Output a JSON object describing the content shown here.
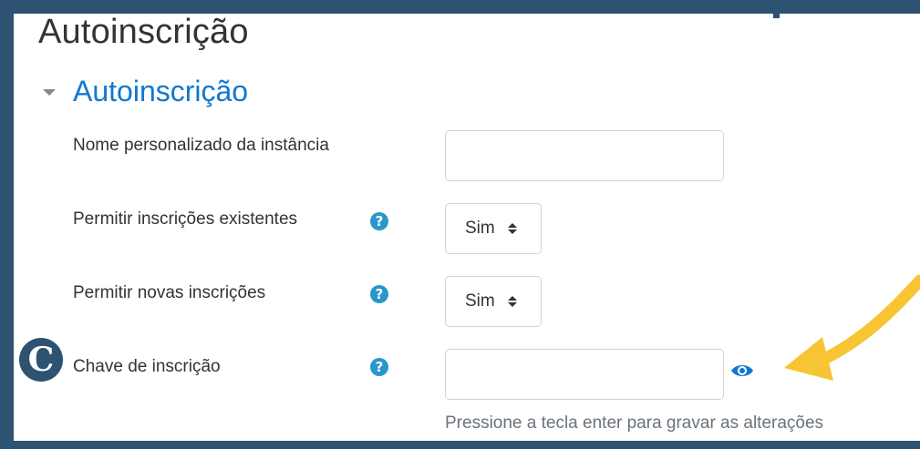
{
  "page": {
    "title": "Autoinscrição"
  },
  "section": {
    "title": "Autoinscrição",
    "toggle_icon": "caret-down-icon"
  },
  "form": {
    "instance_name": {
      "label": "Nome personalizado da instância",
      "value": ""
    },
    "allow_existing": {
      "label": "Permitir inscrições existentes",
      "value": "Sim",
      "help_icon": "question-circle-icon"
    },
    "allow_new": {
      "label": "Permitir novas inscrições",
      "value": "Sim",
      "help_icon": "question-circle-icon"
    },
    "enrolment_key": {
      "label": "Chave de inscrição",
      "value": "",
      "help_icon": "question-circle-icon",
      "reveal_icon": "eye-icon",
      "hint": "Pressione a tecla enter para gravar as alterações"
    }
  },
  "help_glyph": "?",
  "badge": {
    "letter": "C"
  },
  "colors": {
    "frame": "#2e5272",
    "link": "#1177d1",
    "help": "#2997cb",
    "arrow": "#f7c433"
  }
}
